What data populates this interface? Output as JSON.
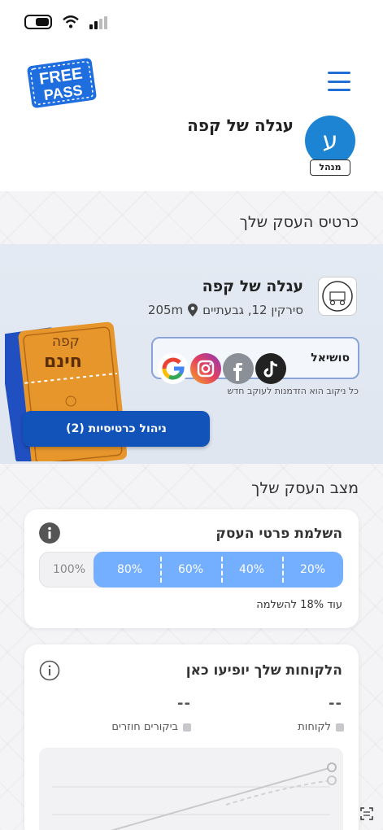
{
  "header": {
    "logo_text": "FREE PASS",
    "business_name": "עגלה של קפה",
    "avatar_letter": "ע",
    "role_badge": "מנהל"
  },
  "card_section": {
    "title": "כרטיס העסק שלך",
    "business_name": "עגלה של קפה",
    "address": "סירקין 12, גבעתיים",
    "distance": "205m",
    "social_label": "סושיאל",
    "social_tagline": "כל ניקוב הוא הזדמנות לעוקב חדש",
    "ticket_line1": "קפה",
    "ticket_line2": "חינם",
    "manage_button": "ניהול כרטיסיות (2)"
  },
  "status_section": {
    "title": "מצב העסק שלך",
    "completion_card": {
      "title": "השלמת פרטי העסק",
      "segments": [
        "20%",
        "40%",
        "60%",
        "80%",
        "100%"
      ],
      "progress": 0.82,
      "remaining_text": "עוד 18% להשלמה"
    },
    "customers_card": {
      "title": "הלקוחות שלך יופיעו כאן",
      "customers_value": "--",
      "returning_value": "--",
      "legend_customers": "לקוחות",
      "legend_returning": "ביקורים חוזרים"
    }
  },
  "colors": {
    "brand_blue": "#1153b8",
    "progress_blue": "#74aeff",
    "avatar_blue": "#1d84d4"
  }
}
